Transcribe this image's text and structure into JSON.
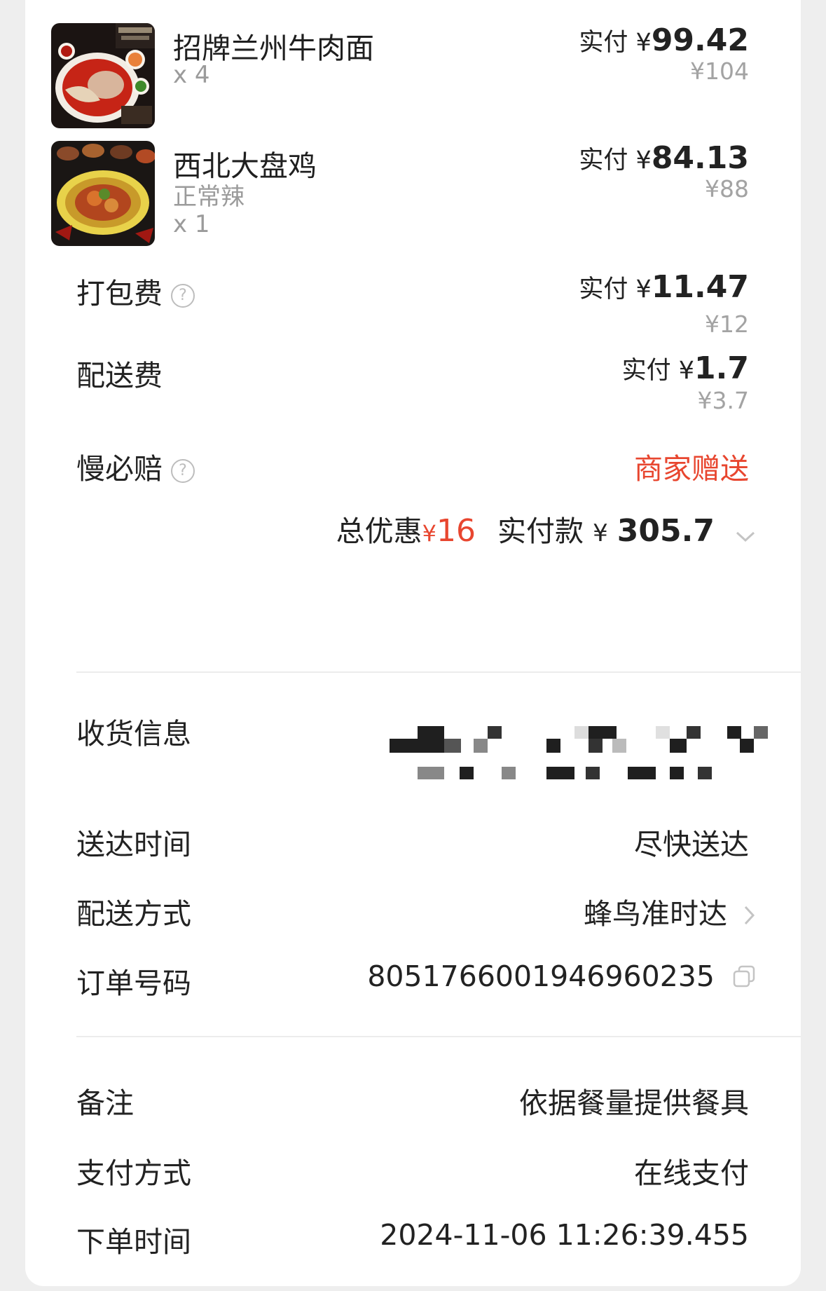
{
  "items": [
    {
      "name": "招牌兰州牛肉面",
      "spec": "",
      "qty": "x 4",
      "pay_label": "实付 ¥",
      "pay_value": "99.42",
      "original": "¥104"
    },
    {
      "name": "西北大盘鸡",
      "spec": "正常辣",
      "qty": "x 1",
      "pay_label": "实付 ¥",
      "pay_value": "84.13",
      "original": "¥88"
    }
  ],
  "fees": {
    "packing": {
      "label": "打包费",
      "pay_label": "实付 ¥",
      "pay_value": "11.47",
      "original": "¥12"
    },
    "delivery": {
      "label": "配送费",
      "pay_label": "实付 ¥",
      "pay_value": "1.7",
      "original": "¥3.7"
    },
    "slow_compensation": {
      "label": "慢必赔",
      "value": "商家赠送"
    }
  },
  "summary": {
    "discount_label": "总优惠",
    "discount_currency": "¥",
    "discount_value": "16",
    "total_label": "实付款",
    "total_currency": "¥",
    "total_value": "305.7"
  },
  "info": {
    "receiver": {
      "label": "收货信息"
    },
    "delivery_time": {
      "label": "送达时间",
      "value": "尽快送达"
    },
    "delivery_method": {
      "label": "配送方式",
      "value": "蜂鸟准时达"
    },
    "order_no": {
      "label": "订单号码",
      "value": "8051766001946960235"
    }
  },
  "extra": {
    "remark": {
      "label": "备注",
      "value": "依据餐量提供餐具"
    },
    "payment": {
      "label": "支付方式",
      "value": "在线支付"
    },
    "order_time": {
      "label": "下单时间",
      "value": "2024-11-06 11:26:39.455"
    }
  },
  "colors": {
    "accent_red": "#e8462f",
    "text": "#222222",
    "muted": "#9b9b9b"
  },
  "icons": [
    "help-circle-icon",
    "chevron-down-icon",
    "chevron-right-icon",
    "copy-icon"
  ]
}
